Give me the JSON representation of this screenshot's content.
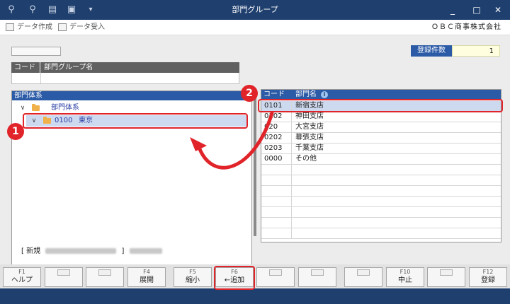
{
  "titlebar": {
    "title": "部門グループ",
    "icons": [
      "search-plus-icon",
      "search-icon",
      "print-icon",
      "export-icon",
      "dropdown-icon"
    ],
    "minimize": "_",
    "maximize": "□",
    "close": "✕"
  },
  "toolbar": {
    "create_data": "データ作成",
    "import_data": "データ受入",
    "company": "ＯＢＣ商事株式会社"
  },
  "count": {
    "label": "登録件数",
    "value": "1"
  },
  "group_table": {
    "headers": [
      "コード",
      "部門グループ名"
    ]
  },
  "tree": {
    "header": "部門体系",
    "root": "部門体系",
    "child_code": "0100",
    "child_name": "東京"
  },
  "list": {
    "headers": [
      "コード",
      "部門名"
    ],
    "info_icon": "i",
    "rows": [
      {
        "code": "0101",
        "name": "新宿支店"
      },
      {
        "code": "0102",
        "name": "神田支店"
      },
      {
        "code": "020",
        "name": "大宮支店"
      },
      {
        "code": "0202",
        "name": "幕張支店"
      },
      {
        "code": "0203",
        "name": "千葉支店"
      },
      {
        "code": "0000",
        "name": "その他"
      }
    ]
  },
  "status": {
    "prefix": "[ 新規",
    "suffix": "]"
  },
  "fkeys": [
    {
      "num": "F1",
      "label": "ヘルプ"
    },
    {
      "num": "",
      "label": ""
    },
    {
      "num": "",
      "label": ""
    },
    {
      "num": "F4",
      "label": "展開"
    },
    {
      "num": "F5",
      "label": "縮小"
    },
    {
      "num": "F6",
      "label": "←追加"
    },
    {
      "num": "",
      "label": ""
    },
    {
      "num": "",
      "label": ""
    },
    {
      "num": "",
      "label": ""
    },
    {
      "num": "F10",
      "label": "中止"
    },
    {
      "num": "",
      "label": ""
    },
    {
      "num": "F12",
      "label": "登録"
    }
  ],
  "callouts": {
    "one": "1",
    "two": "2"
  },
  "colors": {
    "titlebar": "#1f3f6e",
    "header_blue": "#2b5aa6",
    "highlight_red": "#e0242a",
    "selection": "#cdd9ee"
  }
}
